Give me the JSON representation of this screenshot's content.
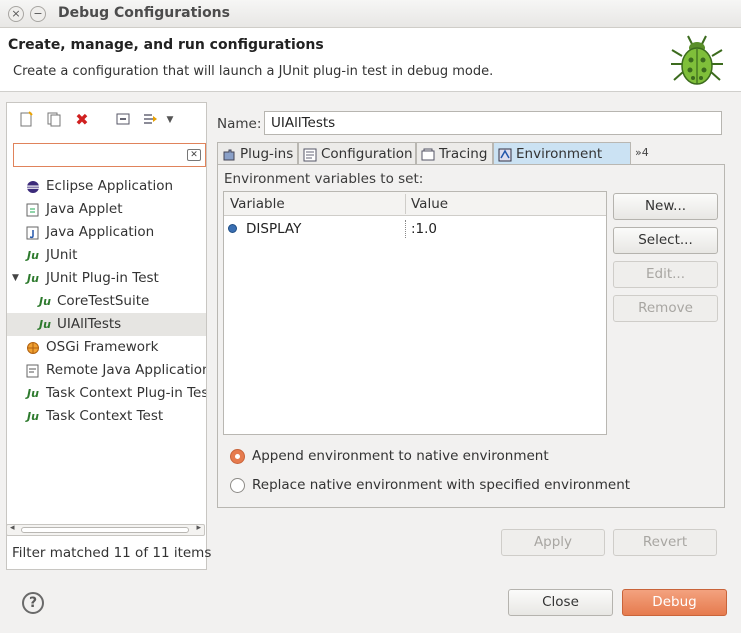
{
  "window": {
    "title": "Debug Configurations",
    "close_glyph": "×",
    "minimize_glyph": "−"
  },
  "banner": {
    "title": "Create, manage, and run configurations",
    "description": "Create a configuration that will launch a JUnit plug-in test in debug mode."
  },
  "left_pane": {
    "toolbar": [
      "new-launch-config-icon",
      "duplicate-icon",
      "delete-icon",
      "collapse-all-icon",
      "filter-icon",
      "dropdown-arrow-icon"
    ],
    "filter_value": "",
    "tree": [
      {
        "label": "Eclipse Application",
        "icon": "eclipse-icon",
        "level": 0
      },
      {
        "label": "Java Applet",
        "icon": "java-applet-icon",
        "level": 0
      },
      {
        "label": "Java Application",
        "icon": "java-app-icon",
        "level": 0
      },
      {
        "label": "JUnit",
        "icon": "junit-icon",
        "level": 0
      },
      {
        "label": "JUnit Plug-in Test",
        "icon": "junit-plugin-icon",
        "level": 0,
        "expanded": true
      },
      {
        "label": "CoreTestSuite",
        "icon": "junit-plugin-icon",
        "level": 1
      },
      {
        "label": "UIAllTests",
        "icon": "junit-plugin-icon",
        "level": 1,
        "selected": true
      },
      {
        "label": "OSGi Framework",
        "icon": "osgi-icon",
        "level": 0
      },
      {
        "label": "Remote Java Application",
        "icon": "remote-java-icon",
        "level": 0
      },
      {
        "label": "Task Context Plug-in Tes",
        "icon": "junit-plugin-icon",
        "level": 0
      },
      {
        "label": "Task Context Test",
        "icon": "junit-icon",
        "level": 0
      }
    ],
    "filter_status": "Filter matched 11 of 11 items"
  },
  "config": {
    "name_label": "Name:",
    "name_value": "UIAllTests",
    "tabs": [
      {
        "label": "Plug-ins",
        "icon": "plugin-icon"
      },
      {
        "label": "Configuration",
        "icon": "configuration-icon"
      },
      {
        "label": "Tracing",
        "icon": "tracing-icon"
      },
      {
        "label": "Environment",
        "icon": "environment-icon",
        "active": true
      }
    ],
    "more_tabs": "»4",
    "env_label": "Environment variables to set:",
    "columns": [
      "Variable",
      "Value"
    ],
    "rows": [
      {
        "variable": "DISPLAY",
        "value": ":1.0"
      }
    ],
    "buttons": {
      "new": "New...",
      "select": "Select...",
      "edit": "Edit...",
      "remove": "Remove"
    },
    "radio_append": "Append environment to native environment",
    "radio_replace": "Replace native environment with specified environment",
    "apply": "Apply",
    "revert": "Revert"
  },
  "footer": {
    "help_glyph": "?",
    "close": "Close",
    "debug": "Debug"
  },
  "colors": {
    "accent": "#e67b4e",
    "selected_tab": "#cbe2f3"
  }
}
